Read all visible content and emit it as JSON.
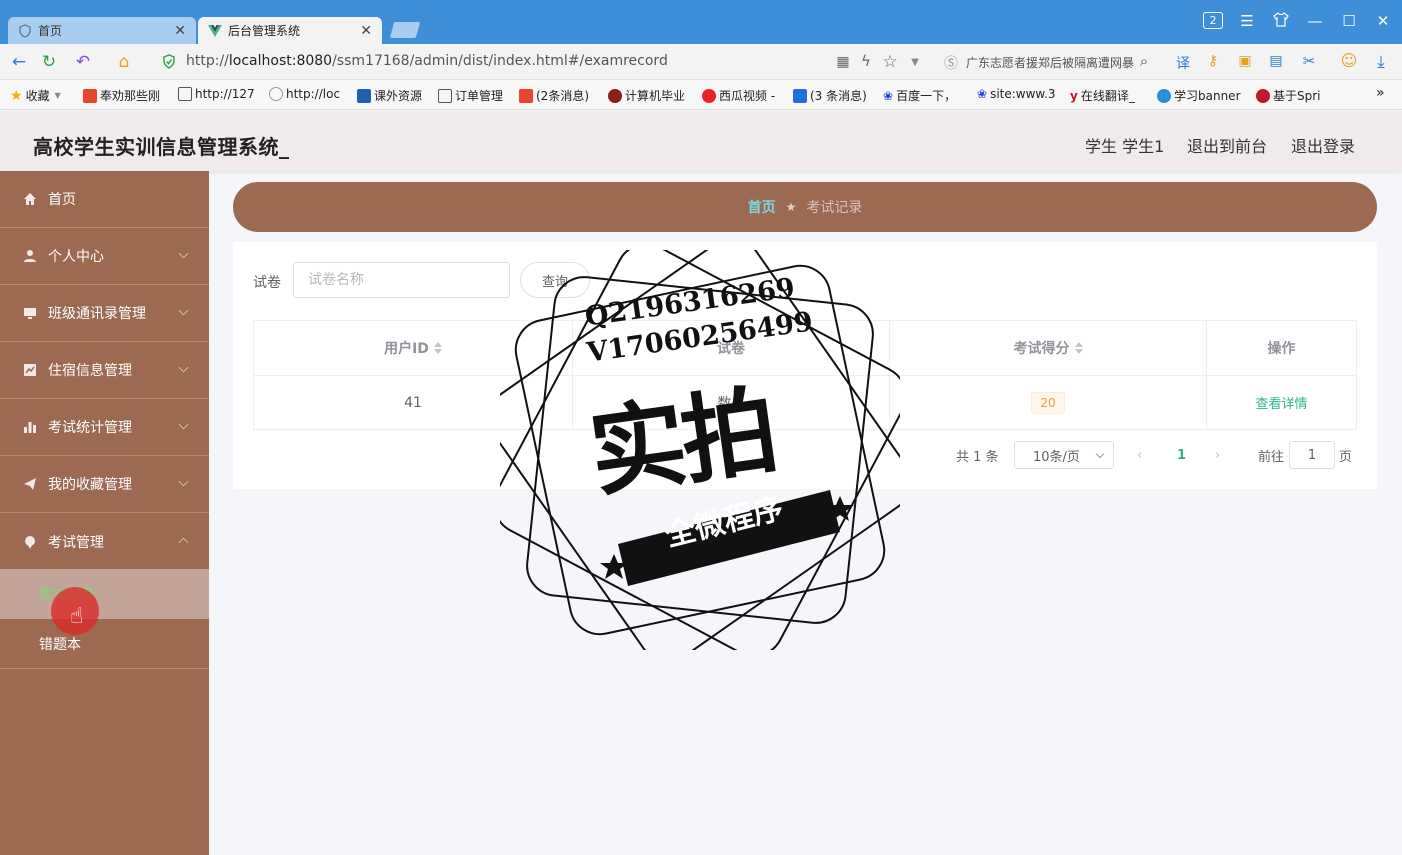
{
  "browser": {
    "tabs": [
      {
        "label": "首页",
        "active": false
      },
      {
        "label": "后台管理系统",
        "active": true
      }
    ],
    "url_prefix": "http://",
    "url_host": "localhost:8080",
    "url_path": "/ssm17168/admin/dist/index.html#/examrecord",
    "search_text": "广东志愿者援郑后被隔离遭网暴",
    "window_badge": "2",
    "bookmarks": [
      {
        "label": "收藏",
        "color": "#f2b400"
      },
      {
        "label": "奉劝那些刚",
        "color": "#e8452c"
      },
      {
        "label": "http://127",
        "color": "#555555"
      },
      {
        "label": "http://loc",
        "color": "#999999"
      },
      {
        "label": "课外资源",
        "color": "#1d5fb3"
      },
      {
        "label": "订单管理",
        "color": "#555555"
      },
      {
        "label": "(2条消息)",
        "color": "#e8452c"
      },
      {
        "label": "计算机毕业",
        "color": "#8b1d1d"
      },
      {
        "label": "西瓜视频 -",
        "color": "#e8202c"
      },
      {
        "label": "(3 条消息)",
        "color": "#1d6fe0"
      },
      {
        "label": "百度一下，",
        "color": "#2a46c6"
      },
      {
        "label": "site:www.3",
        "color": "#2a46c6"
      },
      {
        "label": "在线翻译_",
        "color": "#c0182a"
      },
      {
        "label": "学习banner",
        "color": "#2a8fd8"
      },
      {
        "label": "基于Spri",
        "color": "#c0182a"
      }
    ]
  },
  "header": {
    "title": "高校学生实训信息管理系统_",
    "user": "学生 学生1",
    "back_front": "退出到前台",
    "logout": "退出登录"
  },
  "sidebar": {
    "items": [
      {
        "label": "首页",
        "icon": "home-icon"
      },
      {
        "label": "个人中心",
        "icon": "user-icon"
      },
      {
        "label": "班级通讯录管理",
        "icon": "monitor-icon"
      },
      {
        "label": "住宿信息管理",
        "icon": "chart-icon"
      },
      {
        "label": "考试统计管理",
        "icon": "bar-chart-icon"
      },
      {
        "label": "我的收藏管理",
        "icon": "send-icon"
      },
      {
        "label": "考试管理",
        "icon": "pin-icon"
      }
    ],
    "sub_items": [
      {
        "label": "考试记录",
        "active": true
      },
      {
        "label": "错题本",
        "active": false
      }
    ]
  },
  "breadcrumb": {
    "home": "首页",
    "current": "考试记录"
  },
  "search": {
    "label": "试卷",
    "placeholder": "试卷名称",
    "button": "查询"
  },
  "table": {
    "headers": [
      "用户ID",
      "试卷",
      "考试得分",
      "操作"
    ],
    "rows": [
      {
        "user_id": "41",
        "paper": "数...",
        "score": "20",
        "action": "查看详情"
      }
    ]
  },
  "pagination": {
    "total": "共 1 条",
    "page_size": "10条/页",
    "current_page": "1",
    "goto_label": "前往",
    "goto_value": "1",
    "page_suffix": "页"
  },
  "watermark": {
    "line1": "Q2196316269",
    "line2": "V17060256499",
    "big": "实拍",
    "banner": "全微程序"
  }
}
